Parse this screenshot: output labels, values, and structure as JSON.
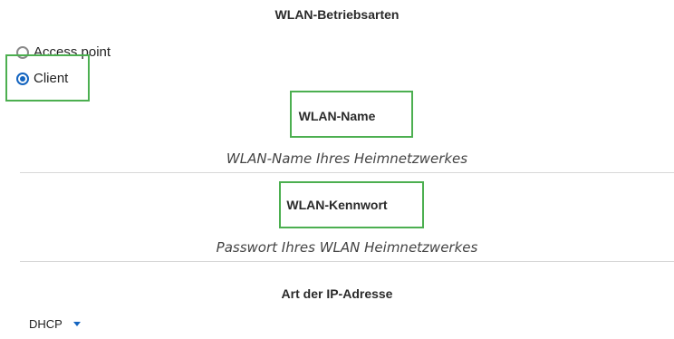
{
  "sections": {
    "mode_heading": "WLAN-Betriebsarten",
    "ip_heading": "Art der IP-Adresse"
  },
  "mode_options": {
    "access_point": "Access point",
    "client": "Client",
    "selected": "Client"
  },
  "wlan_name": {
    "label": "WLAN-Name",
    "placeholder": "WLAN-Name Ihres Heimnetzwerkes"
  },
  "wlan_password": {
    "label": "WLAN-Kennwort",
    "placeholder": "Passwort Ihres WLAN Heimnetzwerkes"
  },
  "ip_type": {
    "selected": "DHCP"
  },
  "colors": {
    "highlight": "#4caf50",
    "accent": "#1565c0"
  },
  "icons": {
    "dropdown": "chevron-down-icon"
  }
}
